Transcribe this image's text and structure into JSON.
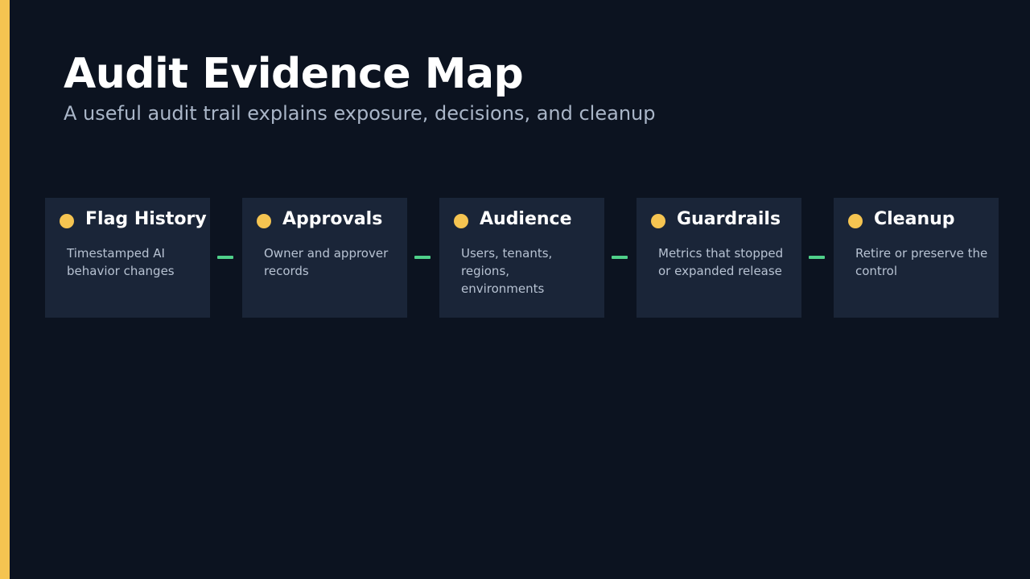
{
  "header": {
    "title": "Audit Evidence Map",
    "subtitle": "A useful audit trail explains exposure, decisions, and cleanup"
  },
  "colors": {
    "background": "#0c1320",
    "accent": "#f5c451",
    "card": "#1a2538",
    "connector": "#4fd08a"
  },
  "steps": [
    {
      "title": "Flag History",
      "description": "Timestamped AI behavior changes"
    },
    {
      "title": "Approvals",
      "description": "Owner and approver records"
    },
    {
      "title": "Audience",
      "description": "Users, tenants, regions, environments"
    },
    {
      "title": "Guardrails",
      "description": "Metrics that stopped or expanded release"
    },
    {
      "title": "Cleanup",
      "description": "Retire or preserve the control"
    }
  ]
}
